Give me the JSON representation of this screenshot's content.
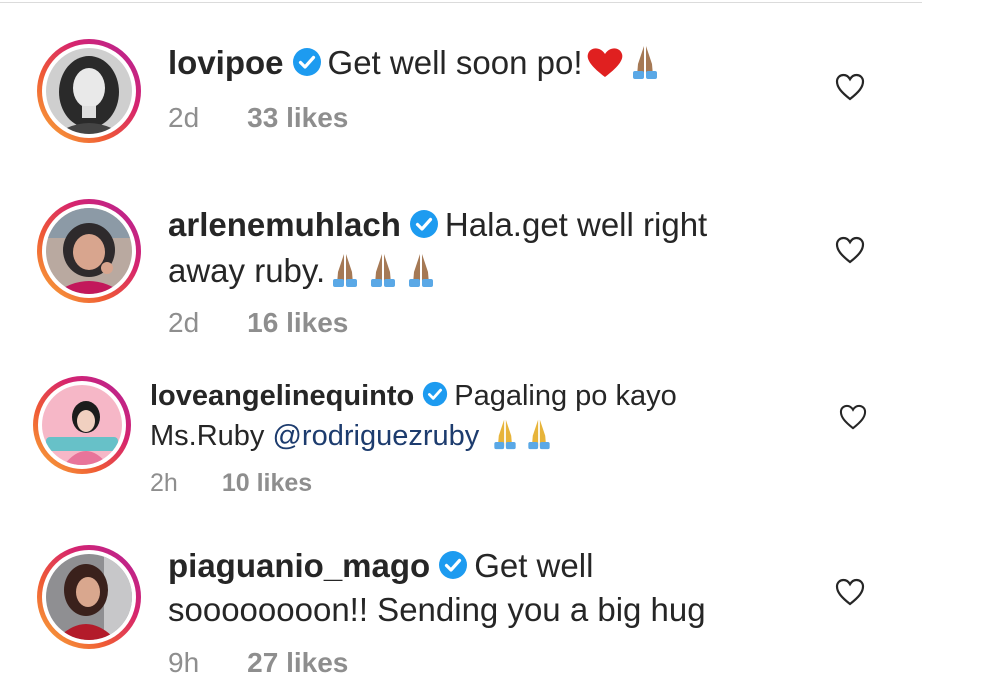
{
  "comments": [
    {
      "username": "lovipoe",
      "text_line1": "Get well soon po!",
      "text_line2": "",
      "mention": "",
      "age": "2d",
      "likes": "33 likes"
    },
    {
      "username": "arlenemuhlach",
      "text_line1": "Hala.get well right",
      "text_line2": "away ruby.",
      "mention": "",
      "age": "2d",
      "likes": "16 likes"
    },
    {
      "username": "loveangelinequinto",
      "text_line1": "Pagaling po kayo",
      "text_line2": "Ms.Ruby ",
      "mention": "@rodriguezruby",
      "age": "2h",
      "likes": "10 likes"
    },
    {
      "username": "piaguanio_mago",
      "text_line1": "Get well",
      "text_line2": "soooooooon!! Sending you a big hug",
      "mention": "",
      "age": "9h",
      "likes": "27 likes"
    }
  ],
  "icons": {
    "verified": "verified-badge-icon",
    "like": "heart-outline-icon",
    "heart_emoji": "red-heart-emoji",
    "pray_emoji": "folded-hands-emoji"
  },
  "colors": {
    "verified": "#1d9bf0",
    "meta": "#8e8e8e",
    "mention": "#1d3c6e",
    "text": "#262626"
  }
}
